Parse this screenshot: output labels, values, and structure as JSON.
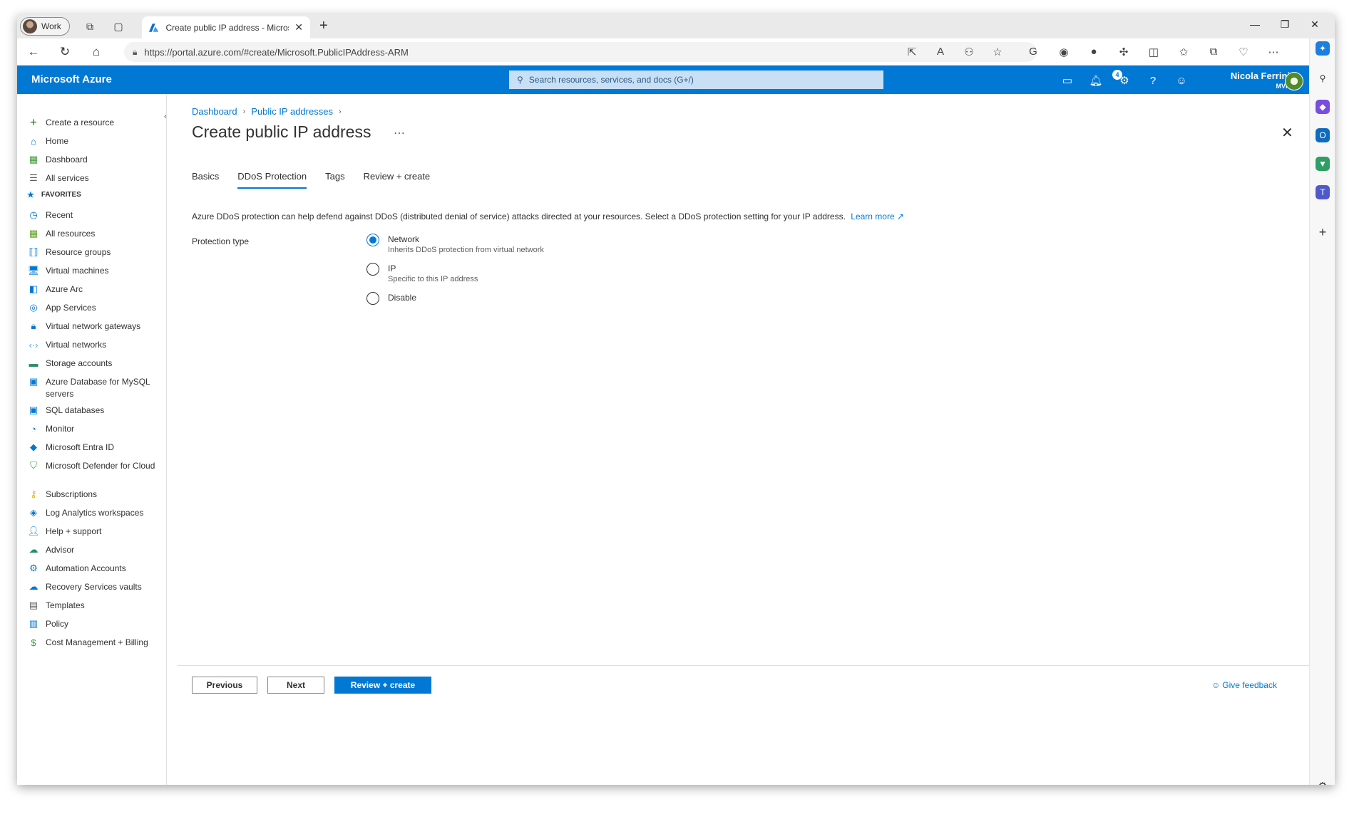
{
  "browser": {
    "profile_label": "Work",
    "tab_title": "Create public IP address - Microsoft Azure",
    "url": "https://portal.azure.com/#create/Microsoft.PublicIPAddress-ARM"
  },
  "header": {
    "brand": "Microsoft Azure",
    "search_placeholder": "Search resources, services, and docs (G+/)",
    "notification_count": "4",
    "user_name": "Nicola Ferrini",
    "user_tag": "MVP"
  },
  "sidebar": {
    "top_items": [
      {
        "label": "Create a resource",
        "icon": "plus-icon"
      },
      {
        "label": "Home",
        "icon": "home-icon"
      },
      {
        "label": "Dashboard",
        "icon": "dashboard-icon"
      },
      {
        "label": "All services",
        "icon": "list-icon"
      }
    ],
    "favorites_header": "FAVORITES",
    "items": [
      {
        "label": "Recent",
        "icon": "clock-icon"
      },
      {
        "label": "All resources",
        "icon": "grid-icon"
      },
      {
        "label": "Resource groups",
        "icon": "resource-group-icon"
      },
      {
        "label": "Virtual machines",
        "icon": "vm-icon"
      },
      {
        "label": "Azure Arc",
        "icon": "arc-icon"
      },
      {
        "label": "App Services",
        "icon": "app-service-icon"
      },
      {
        "label": "Virtual network gateways",
        "icon": "lock-icon"
      },
      {
        "label": "Virtual networks",
        "icon": "vnet-icon"
      },
      {
        "label": "Storage accounts",
        "icon": "storage-icon"
      },
      {
        "label": "Azure Database for MySQL servers",
        "icon": "mysql-icon"
      },
      {
        "label": "SQL databases",
        "icon": "sql-icon"
      },
      {
        "label": "Monitor",
        "icon": "monitor-icon"
      },
      {
        "label": "Microsoft Entra ID",
        "icon": "entra-icon"
      },
      {
        "label": "Microsoft Defender for Cloud",
        "icon": "shield-icon"
      },
      {
        "label": "Subscriptions",
        "icon": "key-icon"
      },
      {
        "label": "Log Analytics workspaces",
        "icon": "analytics-icon"
      },
      {
        "label": "Help + support",
        "icon": "support-icon"
      },
      {
        "label": "Advisor",
        "icon": "advisor-icon"
      },
      {
        "label": "Automation Accounts",
        "icon": "gear-icon"
      },
      {
        "label": "Recovery Services vaults",
        "icon": "cloud-icon"
      },
      {
        "label": "Templates",
        "icon": "template-icon"
      },
      {
        "label": "Policy",
        "icon": "policy-icon"
      },
      {
        "label": "Cost Management + Billing",
        "icon": "cost-icon"
      }
    ]
  },
  "main": {
    "breadcrumb": [
      "Dashboard",
      "Public IP addresses"
    ],
    "title": "Create public IP address",
    "tabs": [
      {
        "label": "Basics",
        "active": false
      },
      {
        "label": "DDoS Protection",
        "active": true
      },
      {
        "label": "Tags",
        "active": false
      },
      {
        "label": "Review + create",
        "active": false
      }
    ],
    "description": "Azure DDoS protection can help defend against DDoS (distributed denial of service) attacks directed at your resources. Select a DDoS protection setting for your IP address.",
    "learn_more": "Learn more",
    "protection_label": "Protection type",
    "options": [
      {
        "label": "Network",
        "sub": "Inherits DDoS protection from virtual network",
        "selected": true
      },
      {
        "label": "IP",
        "sub": "Specific to this IP address",
        "selected": false
      },
      {
        "label": "Disable",
        "sub": "",
        "selected": false
      }
    ]
  },
  "footer": {
    "previous": "Previous",
    "next": "Next",
    "review_create": "Review + create",
    "feedback": "Give feedback"
  },
  "colors": {
    "accent": "#0078d4"
  }
}
